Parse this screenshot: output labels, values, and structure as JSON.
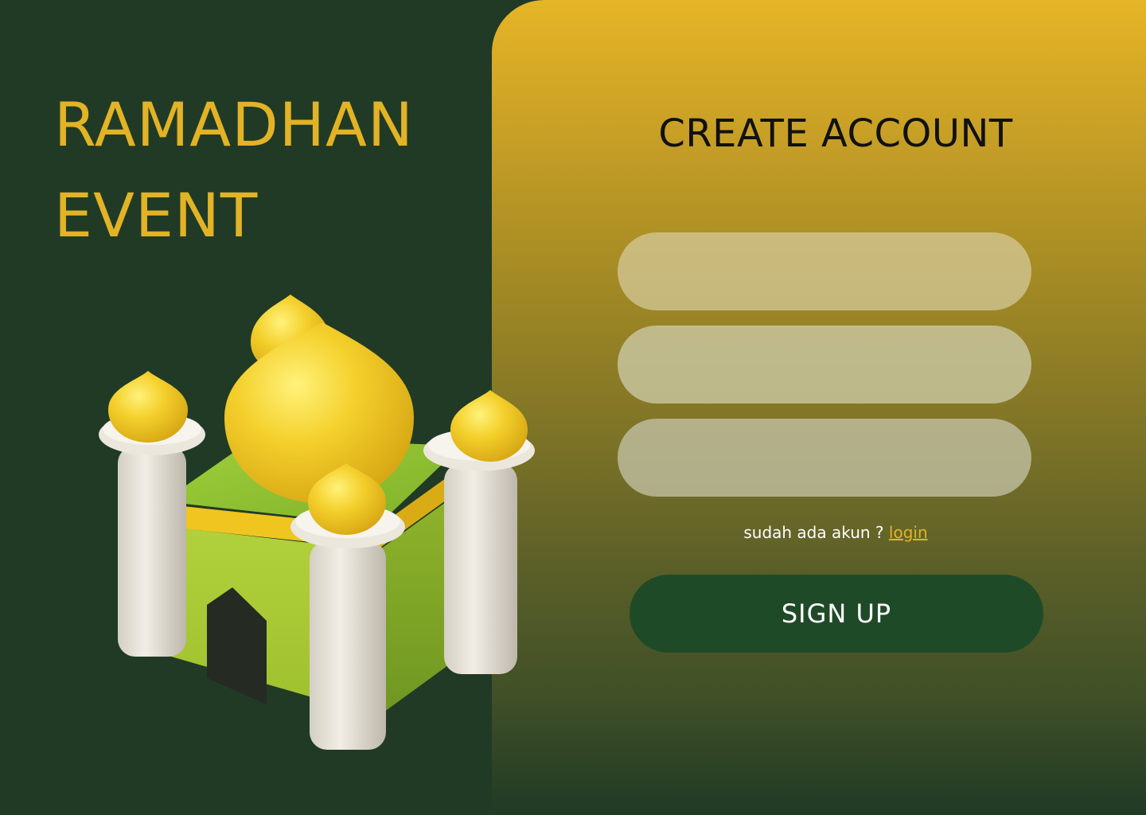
{
  "hero": {
    "title_line1": "RAMADHAN",
    "title_line2": "EVENT",
    "illustration": "mosque-3d-illustration"
  },
  "form": {
    "title": "CREATE ACCOUNT",
    "fields": [
      {
        "value": "",
        "placeholder": ""
      },
      {
        "value": "",
        "placeholder": ""
      },
      {
        "value": "",
        "placeholder": ""
      }
    ],
    "login_prompt": "sudah ada akun ?",
    "login_link": "login",
    "submit_label": "SIGN UP"
  },
  "colors": {
    "background": "#203a26",
    "accent_gold": "#e2b325",
    "button_green": "#1f4a27",
    "dome_yellow": "#f2cc28",
    "mosque_green": "#a8c632",
    "minaret_white": "#e8e4da"
  }
}
